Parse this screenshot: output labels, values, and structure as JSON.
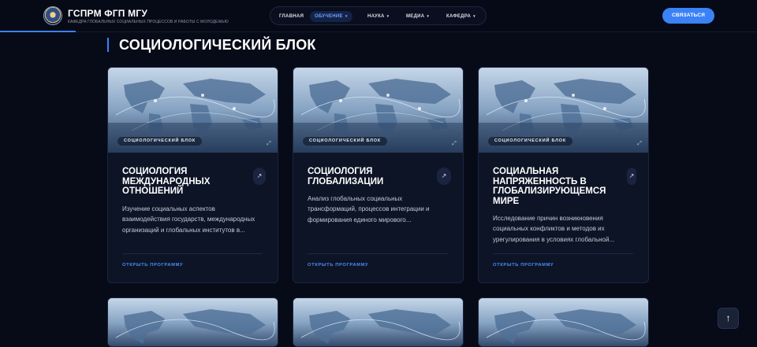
{
  "header": {
    "brand_title": "ГСПРМ ФГП МГУ",
    "brand_subtitle": "КАФЕДРА ГЛОБАЛЬНЫХ СОЦИАЛЬНЫХ ПРОЦЕССОВ И РАБОТЫ С МОЛОДЕЖЬЮ",
    "nav": [
      {
        "label": "ГЛАВНАЯ",
        "has_dropdown": false,
        "active": false
      },
      {
        "label": "ОБУЧЕНИЕ",
        "has_dropdown": true,
        "active": true
      },
      {
        "label": "НАУКА",
        "has_dropdown": true,
        "active": false
      },
      {
        "label": "МЕДИА",
        "has_dropdown": true,
        "active": false
      },
      {
        "label": "КАФЕДРА",
        "has_dropdown": true,
        "active": false
      }
    ],
    "cta_label": "СВЯЗАТЬСЯ"
  },
  "section": {
    "title": "СОЦИОЛОГИЧЕСКИЙ БЛОК"
  },
  "cards": [
    {
      "badge": "СОЦИОЛОГИЧЕСКИЙ БЛОК",
      "title": "СОЦИОЛОГИЯ МЕЖДУНАРОДНЫХ ОТНОШЕНИЙ",
      "description": "Изучение социальных аспектов взаимодействия государств, международных организаций и глобальных институтов в...",
      "link": "ОТКРЫТЬ ПРОГРАММУ"
    },
    {
      "badge": "СОЦИОЛОГИЧЕСКИЙ БЛОК",
      "title": "СОЦИОЛОГИЯ ГЛОБАЛИЗАЦИИ",
      "description": "Анализ глобальных социальных трансформаций, процессов интеграции и формирования единого мирового...",
      "link": "ОТКРЫТЬ ПРОГРАММУ"
    },
    {
      "badge": "СОЦИОЛОГИЧЕСКИЙ БЛОК",
      "title": "СОЦИАЛЬНАЯ НАПРЯЖЕННОСТЬ В ГЛОБАЛИЗИРУЮЩЕМСЯ МИРЕ",
      "description": "Исследование причин возникновения социальных конфликтов и методов их урегулирования в условиях глобальной...",
      "link": "ОТКРЫТЬ ПРОГРАММУ"
    }
  ],
  "icons": {
    "arrow": "↗",
    "chevron": "⌄",
    "scroll_top": "↑"
  },
  "colors": {
    "accent": "#3b82f6",
    "background": "#070b18",
    "card": "#0d1426"
  }
}
